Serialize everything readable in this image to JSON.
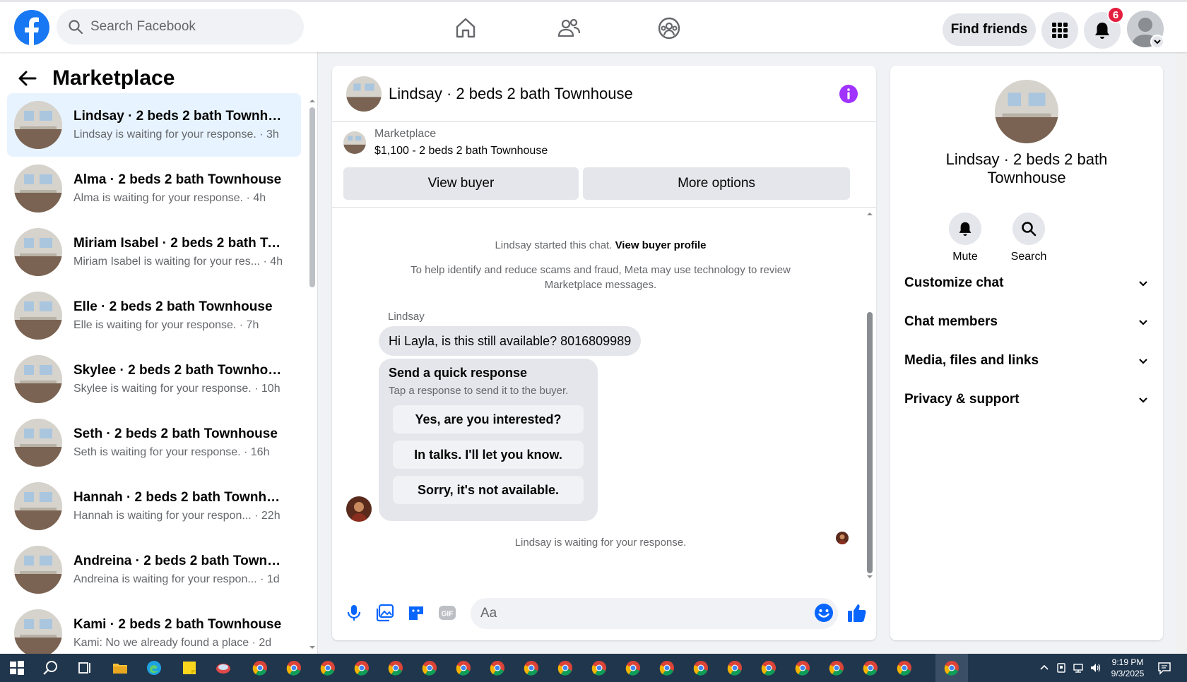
{
  "topbar": {
    "search_placeholder": "Search Facebook",
    "find_friends_label": "Find friends",
    "notification_count": "6",
    "brand_color": "#1877f2"
  },
  "sidebar": {
    "title": "Marketplace",
    "conversations": [
      {
        "title": "Lindsay · 2 beds 2 bath Townhou...",
        "subtitle": "Lindsay is waiting for your response. · 3h",
        "active": true
      },
      {
        "title": "Alma · 2 beds 2 bath Townhouse",
        "subtitle": "Alma is waiting for your response. · 4h"
      },
      {
        "title": "Miriam Isabel · 2 beds 2 bath To...",
        "subtitle": "Miriam Isabel is waiting for your res... · 4h"
      },
      {
        "title": "Elle · 2 beds 2 bath Townhouse",
        "subtitle": "Elle is waiting for your response. · 7h"
      },
      {
        "title": "Skylee · 2 beds 2 bath Townhouse",
        "subtitle": "Skylee is waiting for your response. · 10h"
      },
      {
        "title": "Seth · 2 beds 2 bath Townhouse",
        "subtitle": "Seth is waiting for your response. · 16h"
      },
      {
        "title": "Hannah · 2 beds 2 bath Townhou...",
        "subtitle": "Hannah is waiting for your respon... · 22h"
      },
      {
        "title": "Andreina · 2 beds 2 bath Townho...",
        "subtitle": "Andreina is waiting for your respon... · 1d"
      },
      {
        "title": "Kami · 2 beds 2 bath Townhouse",
        "subtitle": "Kami: No we already found a place · 2d"
      }
    ]
  },
  "chat": {
    "title": "Lindsay · 2 beds 2 bath Townhouse",
    "listing_label": "Marketplace",
    "listing_price": "$1,100 - 2 beds 2 bath Townhouse",
    "view_buyer_label": "View buyer",
    "more_options_label": "More options",
    "started_text": "Lindsay started this chat.",
    "view_profile_label": "View buyer profile",
    "notice_line1": "To help identify and reduce scams and fraud, Meta may use technology to review",
    "notice_line2": "Marketplace messages.",
    "sender_name": "Lindsay",
    "message": "Hi Layla, is this still available? 8016809989",
    "quick_title": "Send a quick response",
    "quick_sub": "Tap a response to send it to the buyer.",
    "quick_replies": [
      "Yes, are you interested?",
      "In talks. I'll let you know.",
      "Sorry, it's not available."
    ],
    "waiting_text": "Lindsay is waiting for your response.",
    "composer_placeholder": "Aa"
  },
  "right_panel": {
    "name": "Lindsay · 2 beds 2 bath Townhouse",
    "mute_label": "Mute",
    "search_label": "Search",
    "sections": [
      "Customize chat",
      "Chat members",
      "Media, files and links",
      "Privacy & support"
    ]
  },
  "taskbar": {
    "time": "9:19 PM",
    "date": "9/3/2025"
  }
}
